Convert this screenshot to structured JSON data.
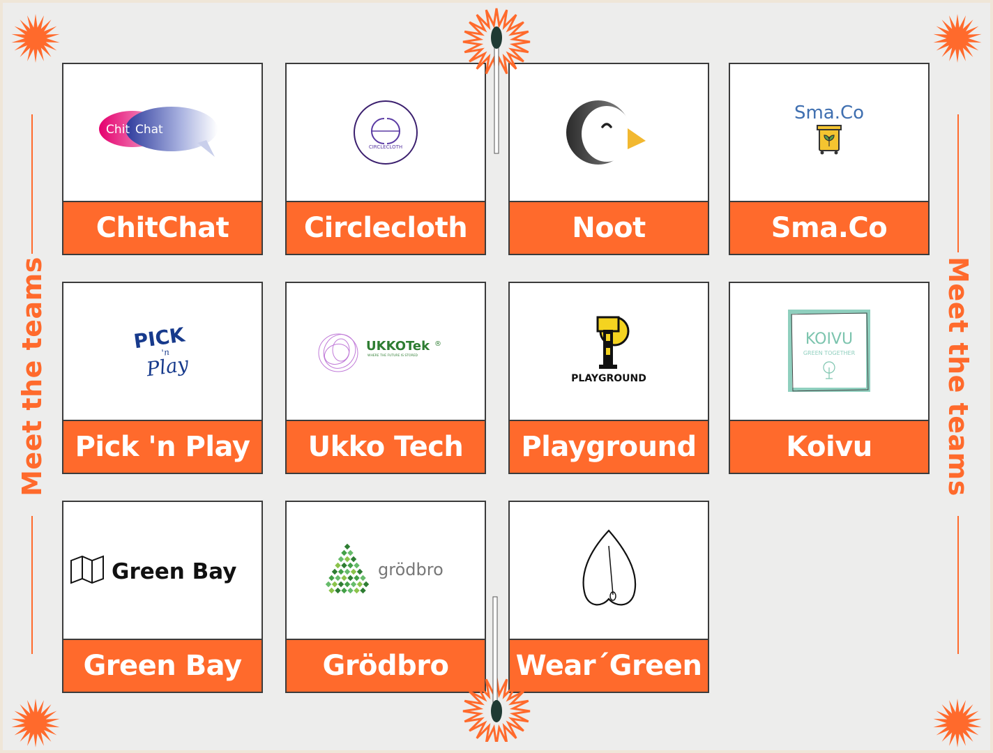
{
  "side_label": "Meet the teams",
  "colors": {
    "accent": "#ff6a2c",
    "background": "#ededec",
    "border": "#3b3b3b",
    "match_head": "#1f3a33"
  },
  "teams": [
    {
      "name": "ChitChat",
      "logo": {
        "icon": "chitchat-speech-bubbles-logo",
        "text": [
          "Chit",
          "Chat"
        ]
      }
    },
    {
      "name": "Circlecloth",
      "logo": {
        "icon": "circlecloth-circle-logo",
        "text": [
          "CIRCLECLOTH"
        ]
      }
    },
    {
      "name": "Noot",
      "logo": {
        "icon": "penguin-logo"
      }
    },
    {
      "name": "Sma.Co",
      "logo": {
        "icon": "recycling-bin-logo",
        "text": [
          "Sma.Co"
        ]
      }
    },
    {
      "name": "Pick 'n Play",
      "logo": {
        "icon": "pick-n-play-logo",
        "text": [
          "PICK",
          "'n",
          "Play"
        ]
      }
    },
    {
      "name": "Ukko Tech",
      "logo": {
        "icon": "scribble-circle-logo",
        "text": [
          "UKKOTek",
          "®",
          "WHERE THE FUTURE IS STORED"
        ]
      }
    },
    {
      "name": "Playground",
      "logo": {
        "icon": "playground-p-logo",
        "text": [
          "PLAYGROUND"
        ]
      }
    },
    {
      "name": "Koivu",
      "logo": {
        "icon": "birch-tree-logo",
        "text": [
          "KOIVU",
          "GREEN TOGETHER"
        ]
      }
    },
    {
      "name": "Green Bay",
      "logo": {
        "icon": "map-icon",
        "text": [
          "Green Bay"
        ]
      }
    },
    {
      "name": "Grödbro",
      "logo": {
        "icon": "green-pixel-leaf-logo",
        "text": [
          "grödbro"
        ]
      }
    },
    {
      "name": "Wear´Green",
      "logo": {
        "icon": "leaf-needle-logo"
      }
    }
  ]
}
